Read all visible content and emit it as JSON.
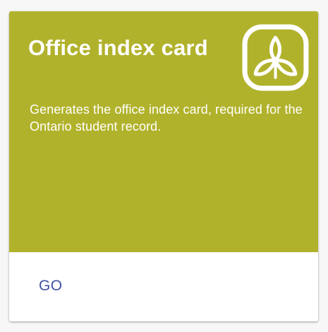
{
  "card": {
    "title": "Office index card",
    "description": "Generates the office index card, required for the Ontario student record.",
    "logo_icon": "ontario-trillium-icon",
    "go_label": "GO"
  },
  "colors": {
    "header_background": "#b1b22b",
    "header_text": "#ffffff",
    "card_background": "#ffffff",
    "button_text": "#3f51a5",
    "page_background": "#f7f7f7"
  }
}
